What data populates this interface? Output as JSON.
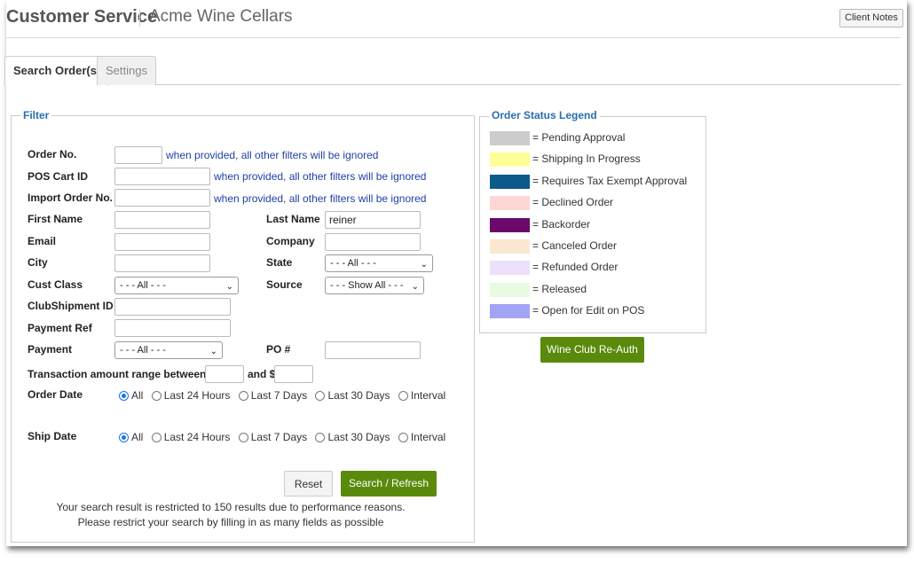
{
  "header": {
    "app_title": "Customer Service",
    "client_name": "Acme Wine Cellars",
    "client_notes_label": "Client Notes"
  },
  "tabs": [
    {
      "label": "Search Order(s)",
      "active": true
    },
    {
      "label": "Settings",
      "active": false
    }
  ],
  "filter": {
    "legend": "Filter",
    "order_no": {
      "label": "Order No.",
      "value": "",
      "hint": "when provided, all other filters will be ignored"
    },
    "pos_cart_id": {
      "label": "POS Cart ID",
      "value": "",
      "hint": "when provided, all other filters will be ignored"
    },
    "import_order_no": {
      "label": "Import Order No.",
      "value": "",
      "hint": "when provided, all other filters will be ignored"
    },
    "first_name": {
      "label": "First Name",
      "value": ""
    },
    "last_name": {
      "label": "Last Name",
      "value": "reiner"
    },
    "email": {
      "label": "Email",
      "value": ""
    },
    "company": {
      "label": "Company",
      "value": ""
    },
    "city": {
      "label": "City",
      "value": ""
    },
    "state": {
      "label": "State",
      "selected": "- - - All - - -"
    },
    "cust_class": {
      "label": "Cust Class",
      "selected": "- - - All - - -"
    },
    "source": {
      "label": "Source",
      "selected": "- - - Show All - - -"
    },
    "club_shipment_id": {
      "label": "ClubShipment ID",
      "value": ""
    },
    "payment_ref": {
      "label": "Payment Ref",
      "value": ""
    },
    "payment": {
      "label": "Payment",
      "selected": "- - - All - - -"
    },
    "po_number": {
      "label": "PO #",
      "value": ""
    },
    "txn_range": {
      "label": "Transaction amount range between: $",
      "and_label": "and $",
      "min": "",
      "max": ""
    },
    "order_date": {
      "label": "Order Date",
      "options": [
        "All",
        "Last 24 Hours",
        "Last 7 Days",
        "Last 30 Days",
        "Interval"
      ],
      "selected": "All"
    },
    "ship_date": {
      "label": "Ship Date",
      "options": [
        "All",
        "Last 24 Hours",
        "Last 7 Days",
        "Last 30 Days",
        "Interval"
      ],
      "selected": "All"
    },
    "reset_label": "Reset",
    "search_label": "Search / Refresh",
    "note_line1": "Your search result is restricted to 150 results due to performance reasons.",
    "note_line2": "Please restrict your search by filling in as many fields as possible"
  },
  "legend": {
    "title": "Order Status Legend",
    "items": [
      {
        "label": "= Pending Approval",
        "color": "#cccccc"
      },
      {
        "label": "= Shipping In Progress",
        "color": "#ffff99"
      },
      {
        "label": "= Requires Tax Exempt Approval",
        "color": "#0b5a8a"
      },
      {
        "label": "= Declined Order",
        "color": "#ffd6d6"
      },
      {
        "label": "= Backorder",
        "color": "#6b0a6b"
      },
      {
        "label": "= Canceled Order",
        "color": "#fbe7d0"
      },
      {
        "label": "= Refunded Order",
        "color": "#ece0fa"
      },
      {
        "label": "= Released",
        "color": "#e6fbdf"
      },
      {
        "label": "= Open for Edit on POS",
        "color": "#a3a3f5"
      }
    ],
    "wine_club_reauth_label": "Wine Club Re-Auth"
  }
}
